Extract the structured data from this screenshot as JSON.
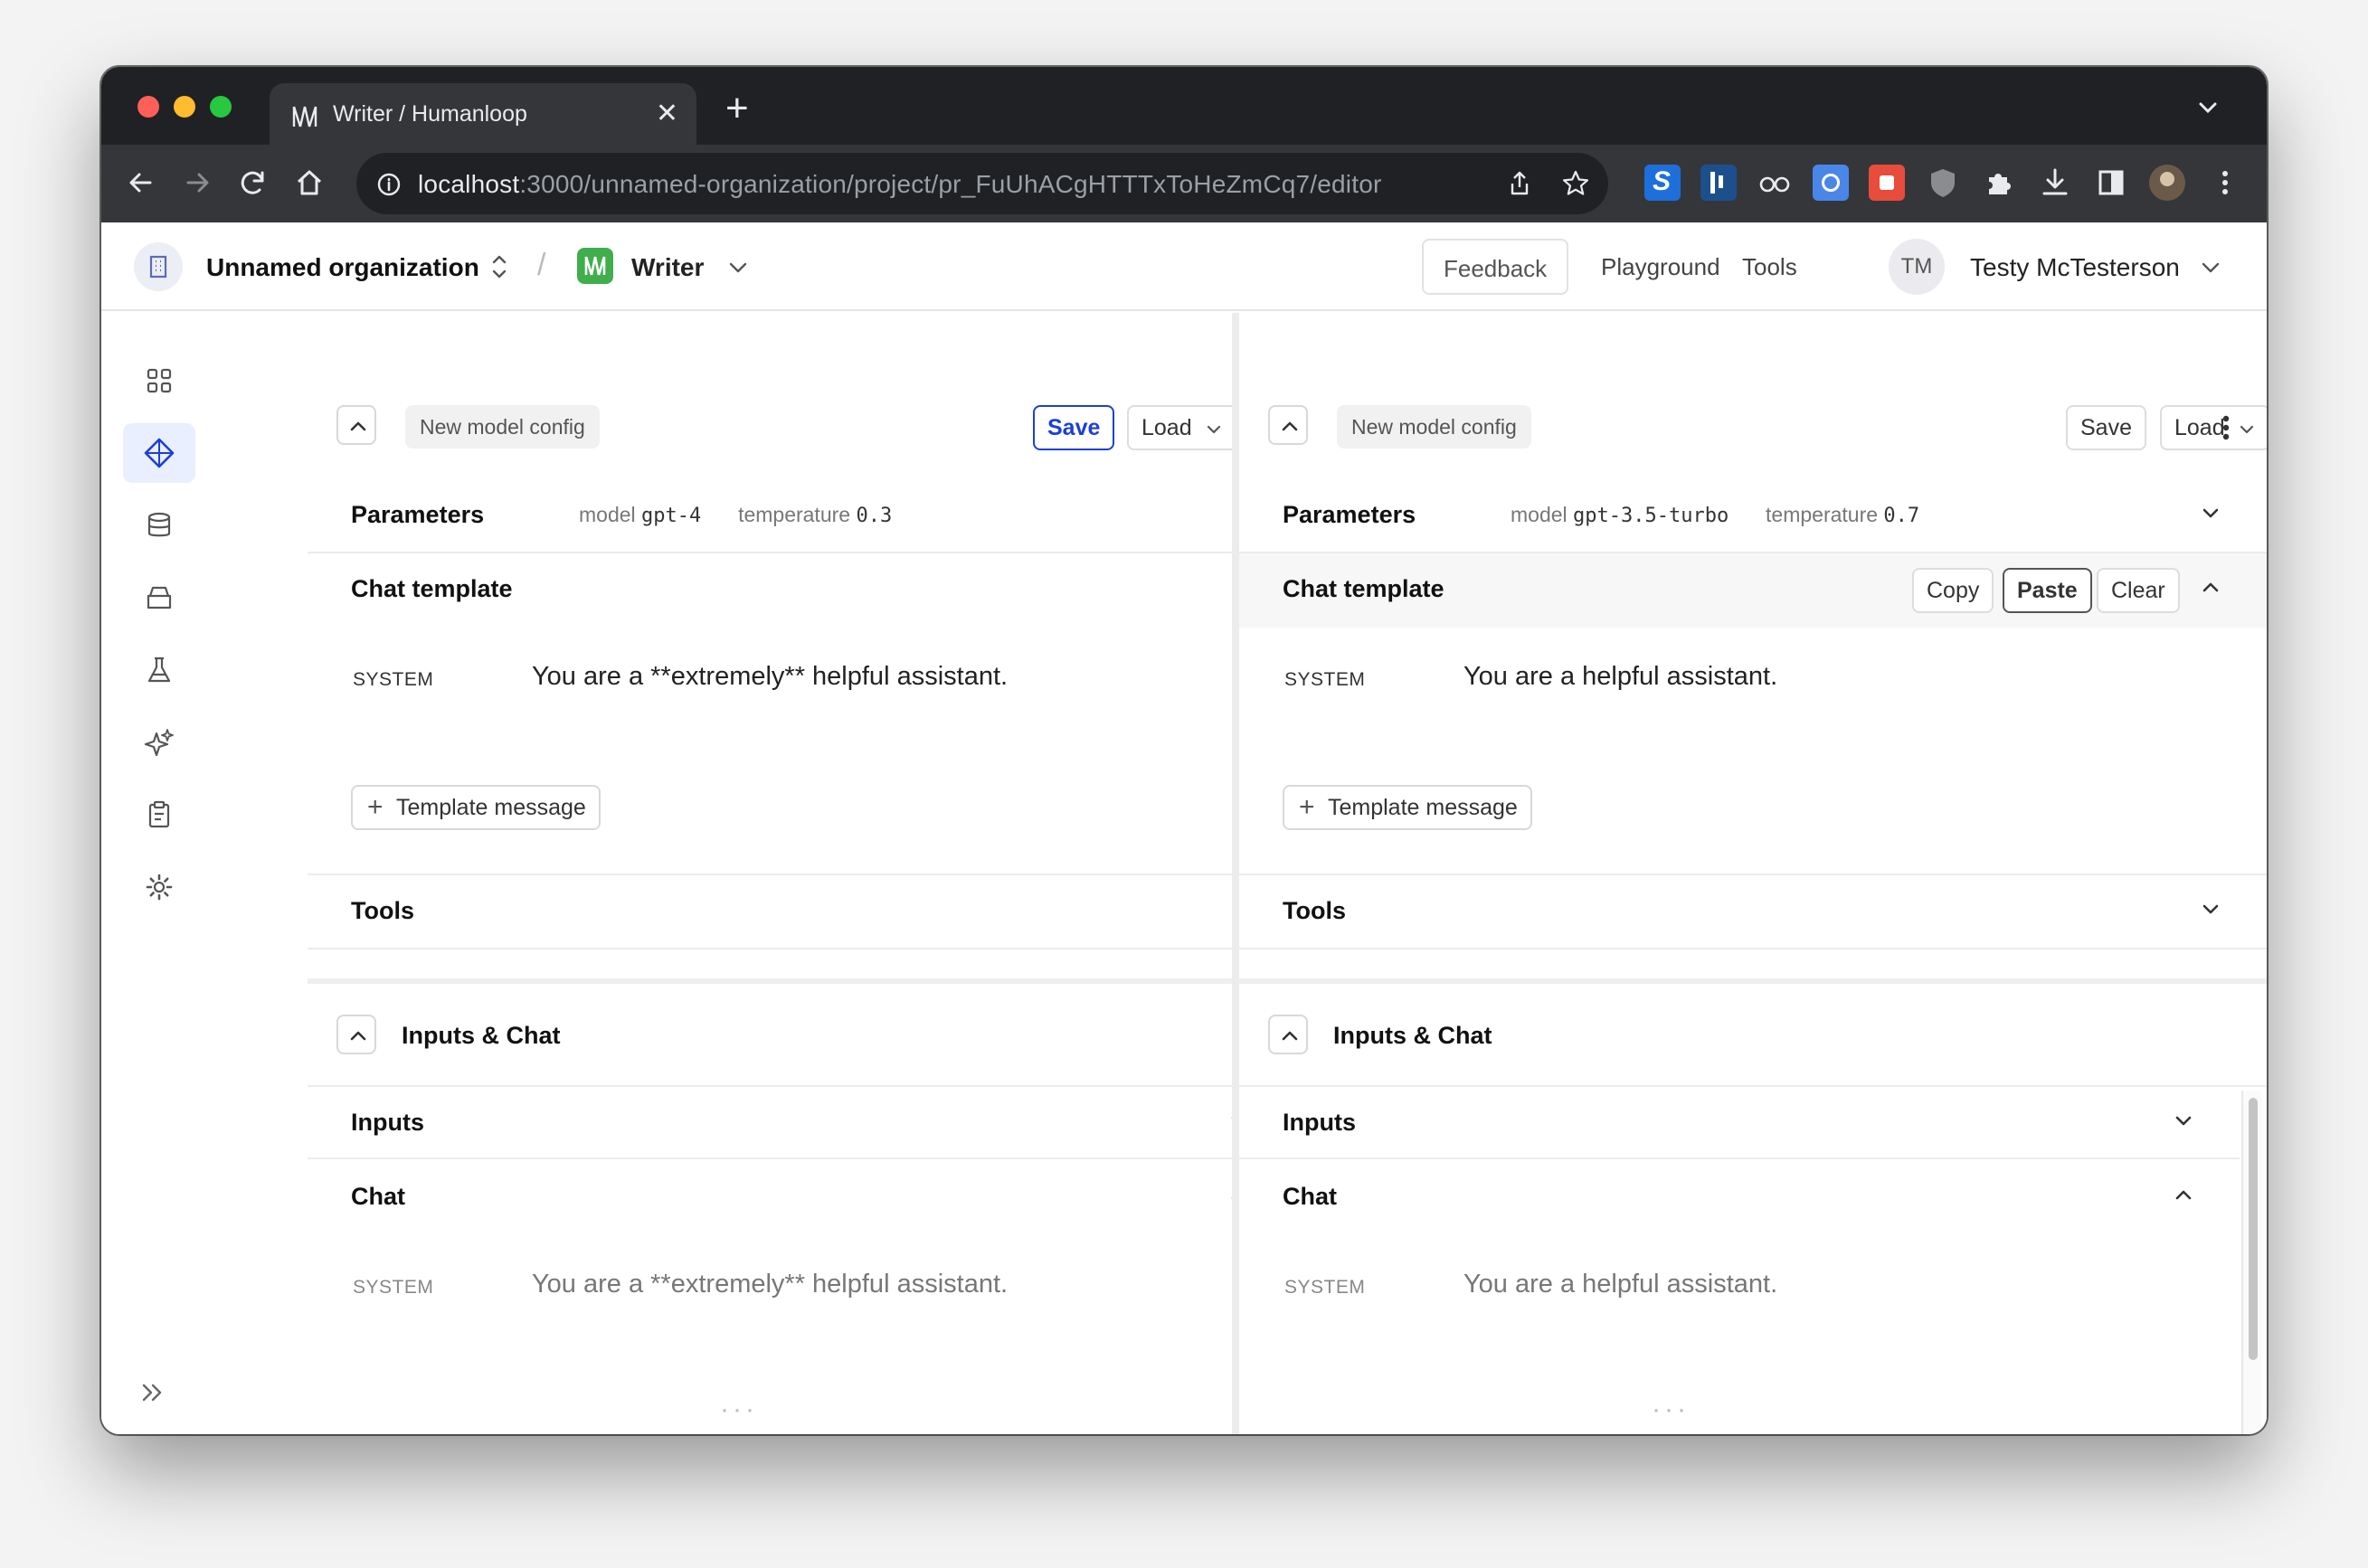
{
  "browser": {
    "tab_title": "Writer / Humanloop",
    "url_host": "localhost",
    "url_path": ":3000/unnamed-organization/project/pr_FuUhACgHTTTxToHeZmCq7/editor"
  },
  "header": {
    "org_name": "Unnamed organization",
    "separator": "/",
    "project_name": "Writer",
    "feedback_label": "Feedback",
    "playground_label": "Playground",
    "tools_label": "Tools",
    "avatar_initials": "TM",
    "user_name": "Testy McTesterson"
  },
  "left": {
    "config_chip": "New model config",
    "save_label": "Save",
    "load_label": "Load",
    "parameters_title": "Parameters",
    "model_key": "model",
    "model_value": "gpt-4",
    "temperature_key": "temperature",
    "temperature_value": "0.3",
    "chat_template_title": "Chat template",
    "system_role": "SYSTEM",
    "system_message": "You are a **extremely** helpful assistant.",
    "template_message_label": "Template message",
    "tools_title": "Tools",
    "inputs_chat_title": "Inputs & Chat",
    "inputs_title": "Inputs",
    "chat_title": "Chat",
    "chat_system_role": "SYSTEM",
    "chat_system_message": "You are a **extremely** helpful assistant.",
    "ellipsis": "···"
  },
  "right": {
    "config_chip": "New model config",
    "save_label": "Save",
    "load_label": "Load",
    "parameters_title": "Parameters",
    "model_key": "model",
    "model_value": "gpt-3.5-turbo",
    "temperature_key": "temperature",
    "temperature_value": "0.7",
    "chat_template_title": "Chat template",
    "copy_label": "Copy",
    "paste_label": "Paste",
    "clear_label": "Clear",
    "system_role": "SYSTEM",
    "system_message": "You are a helpful assistant.",
    "template_message_label": "Template message",
    "tools_title": "Tools",
    "inputs_chat_title": "Inputs & Chat",
    "inputs_title": "Inputs",
    "chat_title": "Chat",
    "chat_system_role": "SYSTEM",
    "chat_system_message": "You are a helpful assistant.",
    "ellipsis": "···"
  },
  "sidebar": {
    "icons": [
      "grid-icon",
      "diamond-icon",
      "database-icon",
      "archive-icon",
      "flask-icon",
      "sparkles-icon",
      "clipboard-icon",
      "gear-icon"
    ],
    "active": "diamond-icon",
    "expand_icon": "double-chevron-right-icon"
  },
  "colors": {
    "accent_blue": "#1c3fd6",
    "project_green": "#3fae4b",
    "chrome_dark": "#202124",
    "chrome_toolbar": "#35363a"
  }
}
